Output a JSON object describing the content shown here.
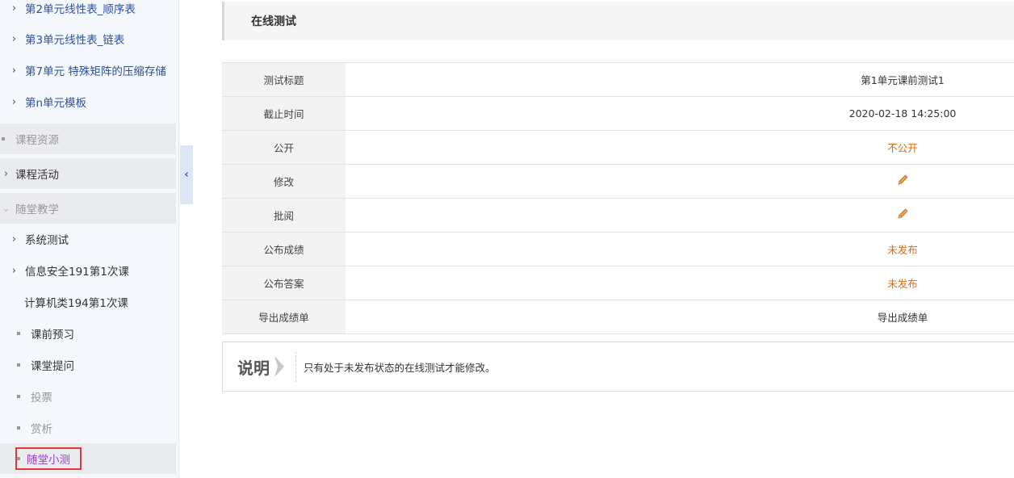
{
  "sidebar": {
    "units": [
      {
        "label": "第2单元线性表_顺序表"
      },
      {
        "label": "第3单元线性表_链表"
      },
      {
        "label": "第7单元 特殊矩阵的压缩存储"
      },
      {
        "label": "第n单元模板"
      }
    ],
    "sections": {
      "resources": "课程资源",
      "activities": "课程活动",
      "classroom": "随堂教学"
    },
    "classroom_items": {
      "system_test": "系统测试",
      "security_class": "信息安全191第1次课",
      "computer_class": "计算机类194第1次课"
    },
    "leaves": {
      "preview": "课前预习",
      "question": "课堂提问",
      "vote": "投票",
      "appreciate": "赏析",
      "quiz": "随堂小测"
    },
    "collapse_icon": "chevron-left-icon"
  },
  "main": {
    "title": "在线测试",
    "rows": {
      "title": {
        "label": "测试标题",
        "value": "第1单元课前测试1"
      },
      "deadline": {
        "label": "截止时间",
        "value": "2020-02-18 14:25:00"
      },
      "public": {
        "label": "公开",
        "value": "不公开"
      },
      "modify": {
        "label": "修改",
        "icon": "pencil-icon"
      },
      "review": {
        "label": "批阅",
        "icon": "pencil-icon"
      },
      "publish_score": {
        "label": "公布成绩",
        "value": "未发布"
      },
      "publish_answer": {
        "label": "公布答案",
        "value": "未发布"
      },
      "export": {
        "label": "导出成绩单",
        "value": "导出成绩单"
      }
    },
    "note": {
      "title": "说明",
      "text": "只有处于未发布状态的在线测试才能修改。"
    }
  },
  "colors": {
    "orange": "#e06b10",
    "nav_blue": "#2e4f9e",
    "active_purple": "#9b3fcf",
    "active_border": "#e0363a"
  }
}
